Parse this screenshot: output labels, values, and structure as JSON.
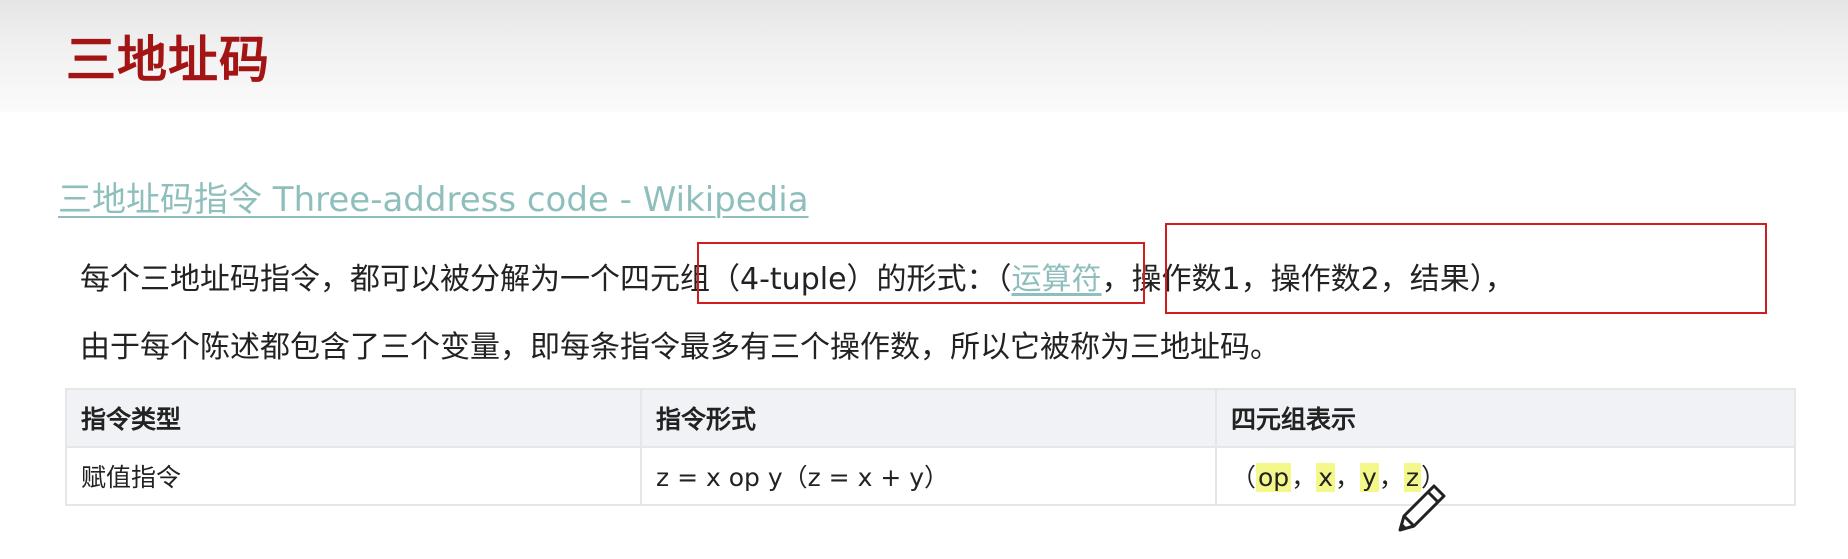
{
  "page": {
    "title": "三地址码",
    "wiki_link": "三地址码指令 Three-address code - Wikipedia"
  },
  "paragraph": {
    "line1_prefix": "每个三地址码指令，都可以被分解为一",
    "line1_boxed_a": "个四元组（4-tuple）的形式：",
    "line1_boxed_b_open": "（",
    "line1_link": "运算符",
    "line1_boxed_b_rest": "，操作数1，操作数2，结果）",
    "line1_suffix": "，",
    "line2": "由于每个陈述都包含了三个变量，即每条指令最多有三个操作数，所以它被称为三地址码。"
  },
  "table": {
    "headers": [
      "指令类型",
      "指令形式",
      "四元组表示"
    ],
    "rows": [
      {
        "type": "赋值指令",
        "form": "z = x op y（z = x + y）",
        "tuple": {
          "open": "（",
          "op": "op",
          "sep1": "，",
          "x": "x",
          "sep2": "，",
          "y": "y",
          "sep3": "，",
          "z": "z",
          "close": "）"
        }
      }
    ]
  },
  "colors": {
    "title": "#a31515",
    "link": "#8fbfbc",
    "box_border": "#d01d1d",
    "highlight": "#f4f78a"
  },
  "icons": {
    "cursor": "pencil-cursor-icon"
  }
}
